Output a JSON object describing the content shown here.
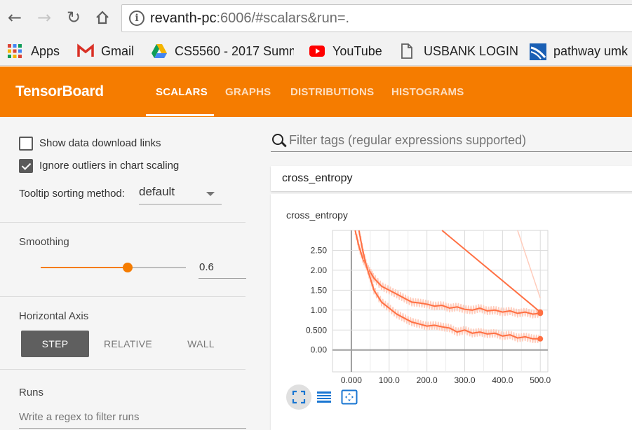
{
  "browser": {
    "url_host": "revanth-pc",
    "url_rest": ":6006/#scalars&run=.",
    "bookmarks": [
      {
        "label": "Apps",
        "icon": "apps-grid-icon"
      },
      {
        "label": "Gmail",
        "icon": "gmail-icon"
      },
      {
        "label": "CS5560 - 2017 Summ",
        "icon": "google-drive-icon"
      },
      {
        "label": "YouTube",
        "icon": "youtube-icon"
      },
      {
        "label": "USBANK LOGIN",
        "icon": "page-icon"
      },
      {
        "label": "pathway umk",
        "icon": "pathway-icon"
      }
    ]
  },
  "header": {
    "title": "TensorBoard",
    "tabs": [
      {
        "label": "SCALARS",
        "active": true
      },
      {
        "label": "GRAPHS",
        "active": false
      },
      {
        "label": "DISTRIBUTIONS",
        "active": false
      },
      {
        "label": "HISTOGRAMS",
        "active": false
      }
    ],
    "color": "#f57c00"
  },
  "sidebar": {
    "show_download_label": "Show data download links",
    "show_download_checked": false,
    "ignore_outliers_label": "Ignore outliers in chart scaling",
    "ignore_outliers_checked": true,
    "tooltip_label": "Tooltip sorting method:",
    "tooltip_value": "default",
    "smoothing_label": "Smoothing",
    "smoothing_value": "0.6",
    "smoothing_fraction": 0.6,
    "horizontal_axis_label": "Horizontal Axis",
    "axis_options": [
      "STEP",
      "RELATIVE",
      "WALL"
    ],
    "axis_selected": "STEP",
    "runs_label": "Runs",
    "runs_placeholder": "Write a regex to filter runs"
  },
  "main": {
    "filter_placeholder": "Filter tags (regular expressions supported)",
    "card_title": "cross_entropy",
    "chart_icons": [
      "fit-domain-icon",
      "toggle-log-scale-icon",
      "reset-zoom-icon"
    ]
  },
  "chart_data": {
    "type": "line",
    "title": "cross_entropy",
    "xlabel": "",
    "ylabel": "",
    "xlim": [
      -50,
      520
    ],
    "ylim": [
      -0.55,
      3.0
    ],
    "x_ticks": [
      "0.000",
      "100.0",
      "200.0",
      "300.0",
      "400.0",
      "500.0"
    ],
    "y_ticks": [
      "0.00",
      "0.500",
      "1.00",
      "1.50",
      "2.00",
      "2.50"
    ],
    "grid": true,
    "color": "#ff7043",
    "series": [
      {
        "x": [
          10,
          20,
          30,
          40,
          50,
          60,
          80,
          100,
          120,
          140,
          160,
          180,
          200,
          220,
          240,
          260,
          280,
          300,
          320,
          340,
          360,
          380,
          400,
          420,
          440,
          460,
          480,
          500
        ],
        "y": [
          3.0,
          2.6,
          2.3,
          2.1,
          1.95,
          1.8,
          1.6,
          1.5,
          1.4,
          1.3,
          1.2,
          1.18,
          1.15,
          1.1,
          1.12,
          1.05,
          1.08,
          1.02,
          1.0,
          1.05,
          0.98,
          1.0,
          0.95,
          0.98,
          0.92,
          0.95,
          0.9,
          0.92
        ]
      },
      {
        "x": [
          20,
          30,
          40,
          50,
          60,
          80,
          100,
          120,
          140,
          160,
          180,
          200,
          220,
          240,
          260,
          280,
          300,
          320,
          340,
          360,
          380,
          400,
          420,
          440,
          460,
          480,
          500
        ],
        "y": [
          3.0,
          2.5,
          2.1,
          1.8,
          1.5,
          1.2,
          1.05,
          0.9,
          0.8,
          0.7,
          0.65,
          0.6,
          0.62,
          0.58,
          0.55,
          0.45,
          0.5,
          0.42,
          0.45,
          0.4,
          0.42,
          0.35,
          0.38,
          0.3,
          0.33,
          0.28,
          0.28
        ]
      },
      {
        "x": [
          240,
          500
        ],
        "y": [
          3.0,
          0.95
        ]
      }
    ]
  }
}
